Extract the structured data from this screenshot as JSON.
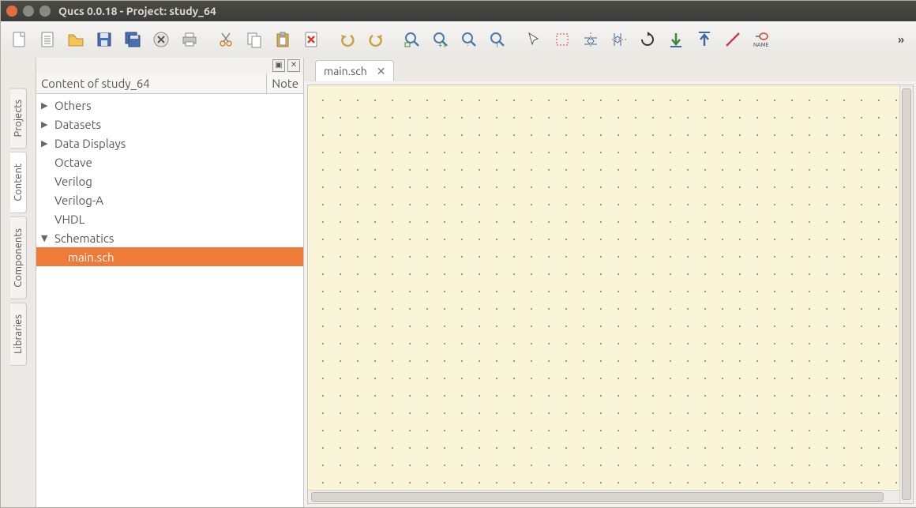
{
  "window": {
    "title": "Qucs 0.0.18 - Project: study_64"
  },
  "titlebar_buttons": {
    "close": "#e46d3f",
    "minimize": "#8a8a85",
    "maximize": "#8a8a85"
  },
  "toolbar": {
    "items": [
      {
        "name": "new-file-icon"
      },
      {
        "name": "new-txt-icon"
      },
      {
        "name": "open-icon"
      },
      {
        "name": "save-icon"
      },
      {
        "name": "save-all-icon"
      },
      {
        "name": "close-file-icon"
      },
      {
        "name": "print-icon"
      },
      {
        "name": "cut-icon"
      },
      {
        "name": "copy-icon"
      },
      {
        "name": "paste-icon"
      },
      {
        "name": "delete-icon"
      },
      {
        "name": "undo-icon"
      },
      {
        "name": "redo-icon"
      },
      {
        "name": "zoom-fit-icon"
      },
      {
        "name": "zoom-in-icon"
      },
      {
        "name": "zoom-out-icon"
      },
      {
        "name": "zoom-1-icon"
      },
      {
        "name": "pointer-icon"
      },
      {
        "name": "select-rect-icon"
      },
      {
        "name": "mirror-h-icon"
      },
      {
        "name": "mirror-v-icon"
      },
      {
        "name": "rotate-icon"
      },
      {
        "name": "move-down-icon"
      },
      {
        "name": "move-up-icon"
      },
      {
        "name": "wire-icon"
      },
      {
        "name": "name-label-icon",
        "text": "NAME"
      }
    ],
    "more": "»"
  },
  "sidetabs": [
    {
      "label": "Projects",
      "active": false
    },
    {
      "label": "Content",
      "active": true
    },
    {
      "label": "Components",
      "active": false
    },
    {
      "label": "Libraries",
      "active": false
    }
  ],
  "panel": {
    "header": {
      "col1": "Content of study_64",
      "col2": "Note"
    },
    "tree": [
      {
        "label": "Others",
        "expandable": true,
        "expanded": false,
        "level": 0
      },
      {
        "label": "Datasets",
        "expandable": true,
        "expanded": false,
        "level": 0
      },
      {
        "label": "Data Displays",
        "expandable": true,
        "expanded": false,
        "level": 0
      },
      {
        "label": "Octave",
        "expandable": false,
        "level": 0
      },
      {
        "label": "Verilog",
        "expandable": false,
        "level": 0
      },
      {
        "label": "Verilog-A",
        "expandable": false,
        "level": 0
      },
      {
        "label": "VHDL",
        "expandable": false,
        "level": 0
      },
      {
        "label": "Schematics",
        "expandable": true,
        "expanded": true,
        "level": 0
      },
      {
        "label": "main.sch",
        "expandable": false,
        "level": 1,
        "selected": true
      }
    ]
  },
  "open_tabs": [
    {
      "label": "main.sch",
      "active": true
    }
  ]
}
